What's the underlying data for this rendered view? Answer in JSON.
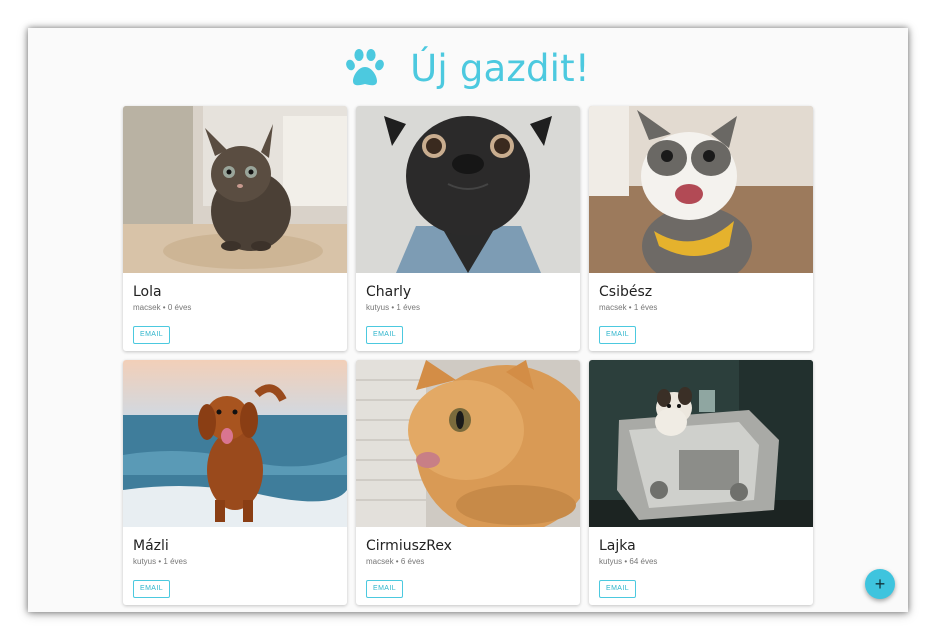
{
  "header": {
    "title": "Új gazdit!",
    "icon": "paw-icon",
    "accent": "#4cc9df"
  },
  "cards": [
    {
      "name": "Lola",
      "species": "macsek",
      "age": "0 éves",
      "sep": "•",
      "email_label": "EMAIL",
      "photo": "kitten-photo"
    },
    {
      "name": "Charly",
      "species": "kutyus",
      "age": "1 éves",
      "sep": "•",
      "email_label": "EMAIL",
      "photo": "pug-photo"
    },
    {
      "name": "Csibész",
      "species": "macsek",
      "age": "1 éves",
      "sep": "•",
      "email_label": "EMAIL",
      "photo": "cat-bandana-photo"
    },
    {
      "name": "Mázli",
      "species": "kutyus",
      "age": "1 éves",
      "sep": "•",
      "email_label": "EMAIL",
      "photo": "dog-beach-photo"
    },
    {
      "name": "CirmiuszRex",
      "species": "macsek",
      "age": "6 éves",
      "sep": "•",
      "email_label": "EMAIL",
      "photo": "orange-cat-photo"
    },
    {
      "name": "Lajka",
      "species": "kutyus",
      "age": "64 éves",
      "sep": "•",
      "email_label": "EMAIL",
      "photo": "space-dog-photo"
    }
  ],
  "fab": {
    "label": "+",
    "icon": "plus-icon"
  }
}
